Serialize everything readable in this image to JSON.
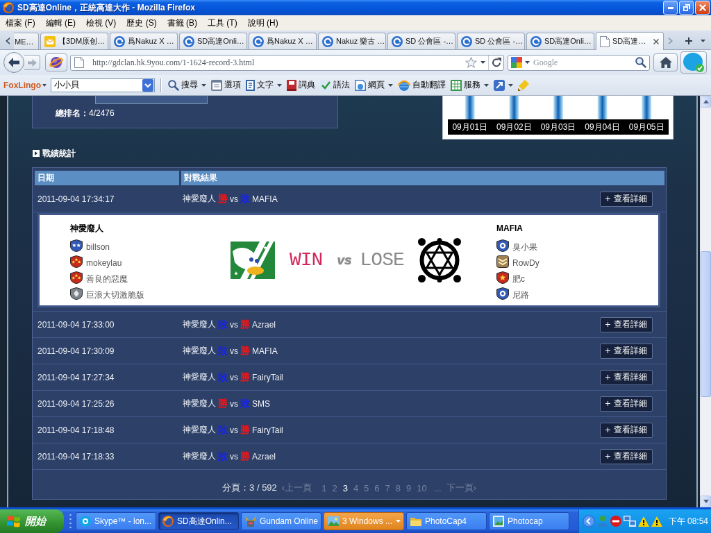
{
  "window": {
    "title": "SD高達Online，正統高達大作 - Mozilla Firefox"
  },
  "menu": [
    "檔案 (F)",
    "編輯 (E)",
    "檢視 (V)",
    "歷史 (S)",
    "書籤 (B)",
    "工具 (T)",
    "說明 (H)"
  ],
  "tabs": [
    {
      "label": "ME…",
      "kind": "plain",
      "selected": false
    },
    {
      "label": "【3DM原创…",
      "kind": "note",
      "selected": false
    },
    {
      "label": "爲Nakuz X …",
      "kind": "ring",
      "selected": false
    },
    {
      "label": "SD高達Onli…",
      "kind": "ring",
      "selected": false
    },
    {
      "label": "爲Nakuz X …",
      "kind": "ring",
      "selected": false
    },
    {
      "label": "Nakuz 樂古 …",
      "kind": "ring",
      "selected": false
    },
    {
      "label": "SD 公會區 -…",
      "kind": "ring",
      "selected": false
    },
    {
      "label": "SD 公會區 -…",
      "kind": "ring",
      "selected": false
    },
    {
      "label": "SD高達Onli…",
      "kind": "ring",
      "selected": false
    },
    {
      "label": "SD高達…",
      "kind": "page",
      "selected": true
    }
  ],
  "navigation": {
    "forward_disabled": true,
    "url": "http://gdclan.hk.9you.com/1-1624-record-3.html",
    "search": {
      "placeholder": "Google"
    }
  },
  "foxlingo": {
    "logo": "FoxLingo",
    "dropdown": {
      "value": "小小貝"
    },
    "tools": [
      {
        "kind": "search",
        "label": "搜尋",
        "menu": true
      },
      {
        "kind": "options",
        "label": "選項",
        "menu": false
      },
      {
        "kind": "text",
        "label": "文字",
        "menu": true
      },
      {
        "kind": "dictionary",
        "label": "詞典",
        "menu": false
      },
      {
        "kind": "grammar",
        "label": "語法",
        "menu": false
      },
      {
        "kind": "web",
        "label": "網頁",
        "menu": true
      },
      {
        "kind": "autotranslate",
        "label": "自動翻譯",
        "menu": false
      },
      {
        "kind": "services",
        "label": "服務",
        "menu": true
      },
      {
        "kind": "translate",
        "menu": true
      },
      {
        "kind": "highlighter",
        "menu": false
      }
    ]
  },
  "summary": {
    "rank_label": "總排名：",
    "rank_value": "4/2476"
  },
  "activity_chart": {
    "labels": [
      "09月01日",
      "09月02日",
      "09月03日",
      "09月04日",
      "09月05日"
    ]
  },
  "section_title": "戰績統計",
  "table": {
    "columns": [
      "日期",
      "對戰結果"
    ],
    "rows": [
      {
        "date": "2011-09-04 17:34:17",
        "team": "神愛廢人",
        "team_result": {
          "text": "勝",
          "won": true
        },
        "vs": "vs",
        "opponent": "MAFIA",
        "opponent_result": {
          "text": "敗",
          "won": false
        },
        "button": "查看詳細",
        "detail": {
          "left": {
            "name": "神愛廢人",
            "players": [
              {
                "name": "billson",
                "kind": "bluestar"
              },
              {
                "name": "mokeylau",
                "kind": "redstar"
              },
              {
                "name": "善良的惡魔",
                "kind": "redstar"
              },
              {
                "name": "巨浪大切激脆版",
                "kind": "silver"
              }
            ],
            "emblem": {
              "kind": "bird"
            },
            "result": "WIN",
            "won": true
          },
          "vs": "vs",
          "right": {
            "name": "MAFIA",
            "players": [
              {
                "name": "臭小果",
                "kind": "blueorb"
              },
              {
                "name": "RowDy",
                "kind": "goldstripe"
              },
              {
                "name": "肥c",
                "kind": "redsingle"
              },
              {
                "name": "尼路",
                "kind": "blueorb"
              }
            ],
            "emblem": {
              "kind": "hexagram"
            },
            "result": "LOSE",
            "won": false
          }
        }
      },
      {
        "date": "2011-09-04 17:33:00",
        "team": "神愛廢人",
        "team_result": {
          "text": "敗",
          "won": false
        },
        "vs": "vs",
        "opponent": "Azrael",
        "opponent_result": {
          "text": "勝",
          "won": true
        },
        "button": "查看詳細"
      },
      {
        "date": "2011-09-04 17:30:09",
        "team": "神愛廢人",
        "team_result": {
          "text": "敗",
          "won": false
        },
        "vs": "vs",
        "opponent": "MAFIA",
        "opponent_result": {
          "text": "勝",
          "won": true
        },
        "button": "查看詳細"
      },
      {
        "date": "2011-09-04 17:27:34",
        "team": "神愛廢人",
        "team_result": {
          "text": "敗",
          "won": false
        },
        "vs": "vs",
        "opponent": "FairyTail",
        "opponent_result": {
          "text": "勝",
          "won": true
        },
        "button": "查看詳細"
      },
      {
        "date": "2011-09-04 17:25:26",
        "team": "神愛廢人",
        "team_result": {
          "text": "勝",
          "won": true
        },
        "vs": "vs",
        "opponent": "SMS",
        "opponent_result": {
          "text": "敗",
          "won": false
        },
        "button": "查看詳細"
      },
      {
        "date": "2011-09-04 17:18:48",
        "team": "神愛廢人",
        "team_result": {
          "text": "敗",
          "won": false
        },
        "vs": "vs",
        "opponent": "FairyTail",
        "opponent_result": {
          "text": "勝",
          "won": true
        },
        "button": "查看詳細"
      },
      {
        "date": "2011-09-04 17:18:33",
        "team": "神愛廢人",
        "team_result": {
          "text": "敗",
          "won": false
        },
        "vs": "vs",
        "opponent": "Azrael",
        "opponent_result": {
          "text": "勝",
          "won": true
        },
        "button": "查看詳細"
      }
    ]
  },
  "pagination": {
    "label": "分頁：3 / 592",
    "prev": "‹上一頁",
    "pages": [
      {
        "label": "1",
        "selected": false
      },
      {
        "label": "2",
        "selected": false
      },
      {
        "label": "3",
        "selected": true
      },
      {
        "label": "4",
        "selected": false
      },
      {
        "label": "5",
        "selected": false
      },
      {
        "label": "6",
        "selected": false
      },
      {
        "label": "7",
        "selected": false
      },
      {
        "label": "8",
        "selected": false
      },
      {
        "label": "9",
        "selected": false
      },
      {
        "label": "10",
        "selected": false
      }
    ],
    "ellipsis": "...",
    "next": "下一頁›"
  },
  "taskbar": {
    "start": "開始",
    "tasks": [
      {
        "label": "Skype™ - lon...",
        "kind": "chat",
        "selected": false,
        "flashing": false
      },
      {
        "label": "SD高達Onlin...",
        "kind": "globe",
        "selected": true,
        "flashing": false
      },
      {
        "label": "Gundam Online",
        "kind": "robot",
        "selected": false,
        "flashing": false
      },
      {
        "label": "3 Windows ...",
        "kind": "group",
        "selected": false,
        "flashing": true
      },
      {
        "label": "PhotoCap4",
        "kind": "folder",
        "selected": false,
        "flashing": false
      },
      {
        "label": "Photocap",
        "kind": "photo",
        "selected": false,
        "flashing": false
      }
    ],
    "clock": "下午 08:54"
  }
}
